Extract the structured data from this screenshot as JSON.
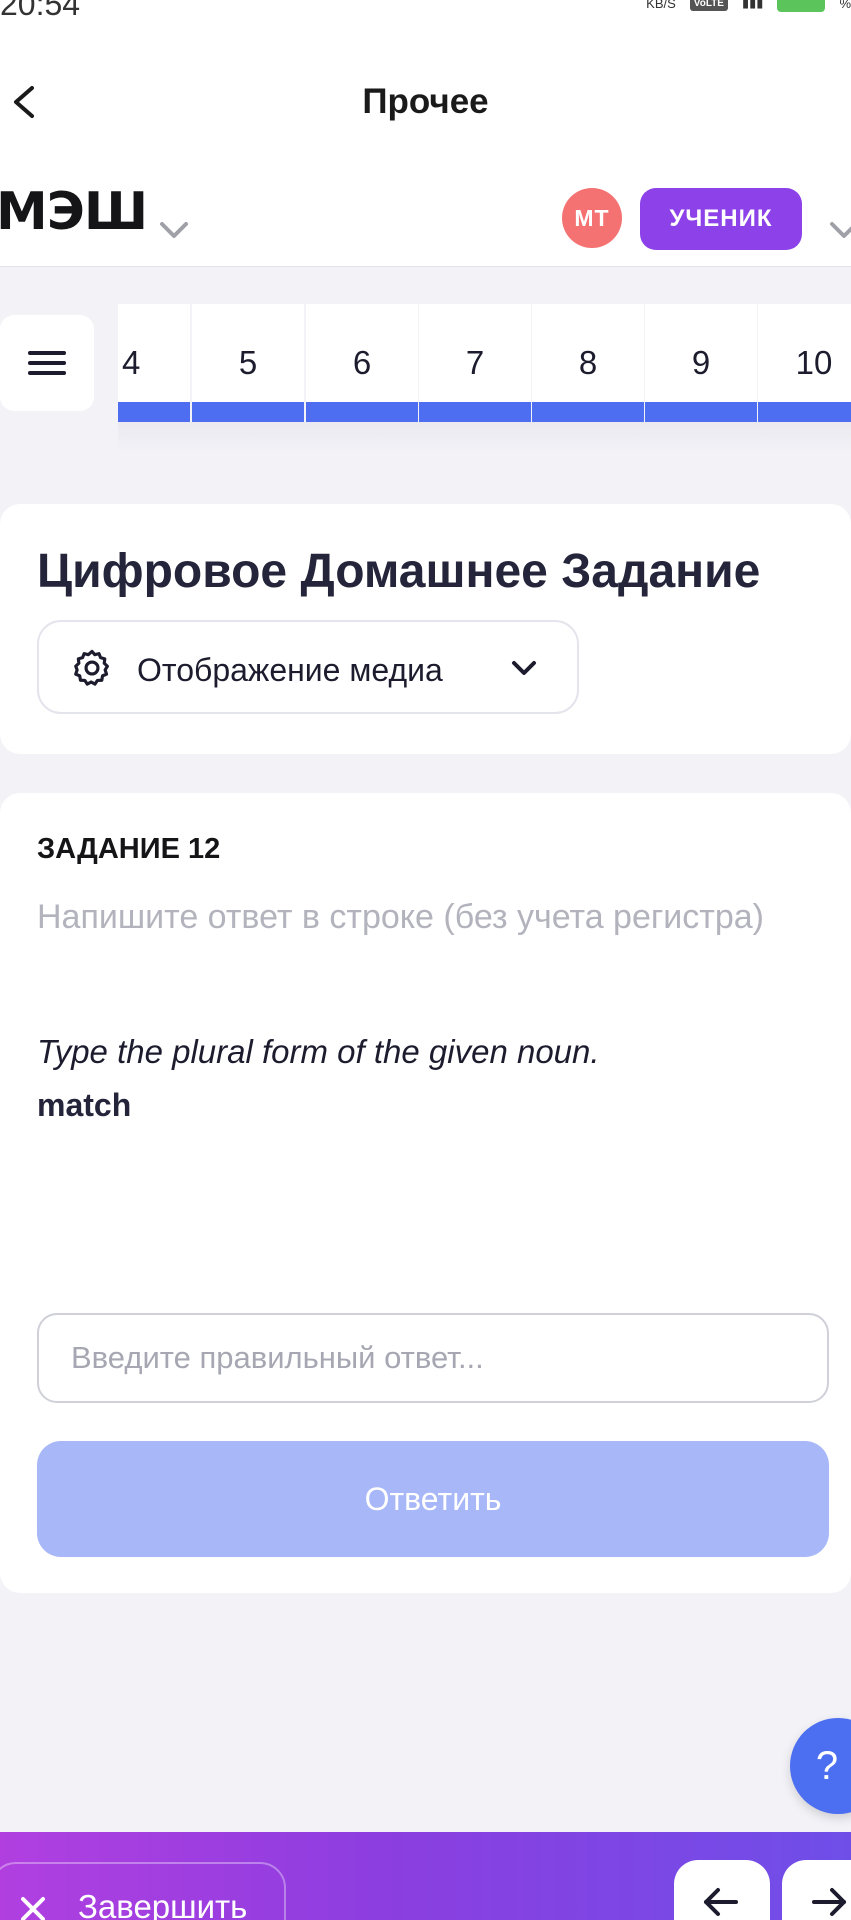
{
  "status_bar": {
    "time": "20:54",
    "speed": "KB/S",
    "network": "VoLTE",
    "battery_suffix": "%"
  },
  "header": {
    "title": "Прочее",
    "brand": "МЭШ",
    "avatar_initials": "МТ",
    "role": "УЧЕНИК"
  },
  "task_nav": {
    "items": [
      "4",
      "5",
      "6",
      "7",
      "8",
      "9",
      "10"
    ],
    "progress_color": "#4d6ef0"
  },
  "homework": {
    "title": "Цифровое Домашнее Задание",
    "media_label": "Отображение медиа"
  },
  "task": {
    "label": "ЗАДАНИЕ 12",
    "instruction": "Напишите ответ в строке (без учета регистра)",
    "prompt": "Type the plural form of the given noun.",
    "word": "match",
    "input_placeholder": "Введите правильный ответ...",
    "input_value": "",
    "submit_label": "Ответить"
  },
  "help": {
    "label": "?"
  },
  "bottom_bar": {
    "finish_label": "Завершить"
  },
  "colors": {
    "accent": "#4d6ef0",
    "role_badge": "#8c42e8",
    "avatar": "#f47272",
    "submit_disabled": "#a7b7f7"
  }
}
